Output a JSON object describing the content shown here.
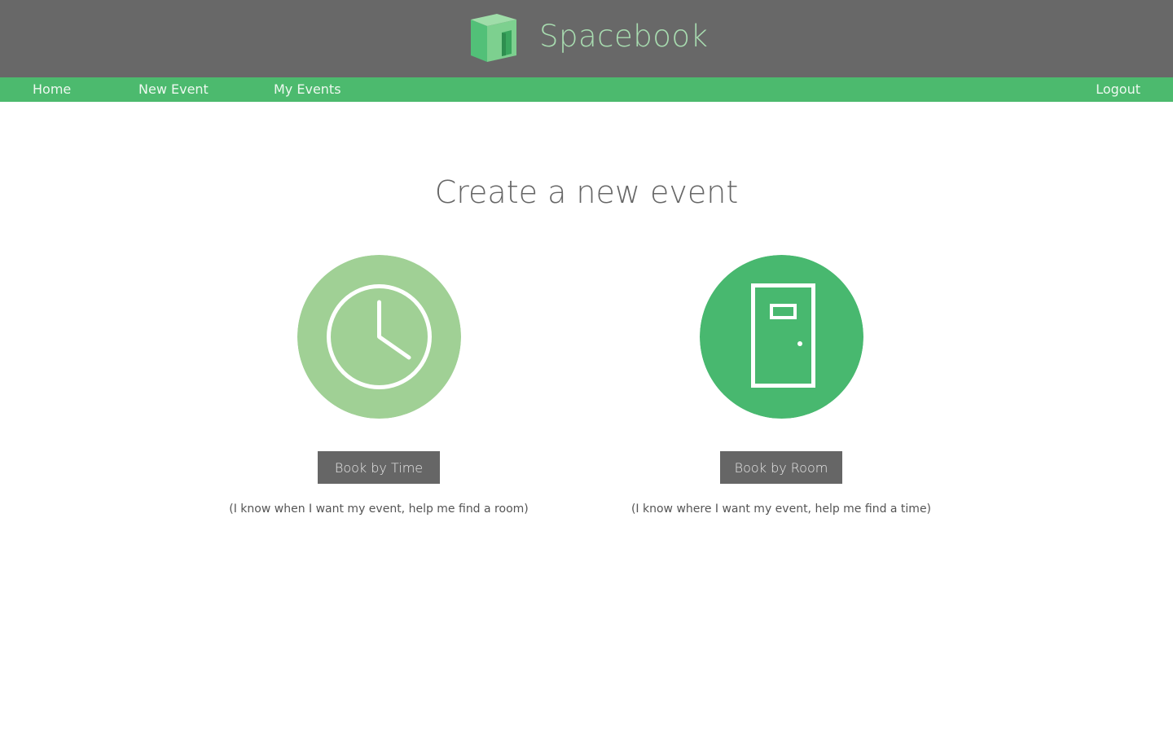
{
  "header": {
    "brand_name": "Spacebook",
    "logo_icon": "green-cube-door-icon"
  },
  "nav": {
    "items": [
      {
        "label": "Home"
      },
      {
        "label": "New Event"
      },
      {
        "label": "My Events"
      }
    ],
    "logout_label": "Logout"
  },
  "main": {
    "title": "Create a new event",
    "options": [
      {
        "icon": "clock-icon",
        "button_label": "Book by Time",
        "description": "(I know when I want my event, help me find a room)"
      },
      {
        "icon": "door-icon",
        "button_label": "Book by Room",
        "description": "(I know where I want my event, help me find a time)"
      }
    ]
  },
  "colors": {
    "header_bg": "#686868",
    "nav_bg": "#4cba6e",
    "clock_circle": "#a0d095",
    "door_circle": "#48b86f",
    "button_bg": "#666666"
  }
}
